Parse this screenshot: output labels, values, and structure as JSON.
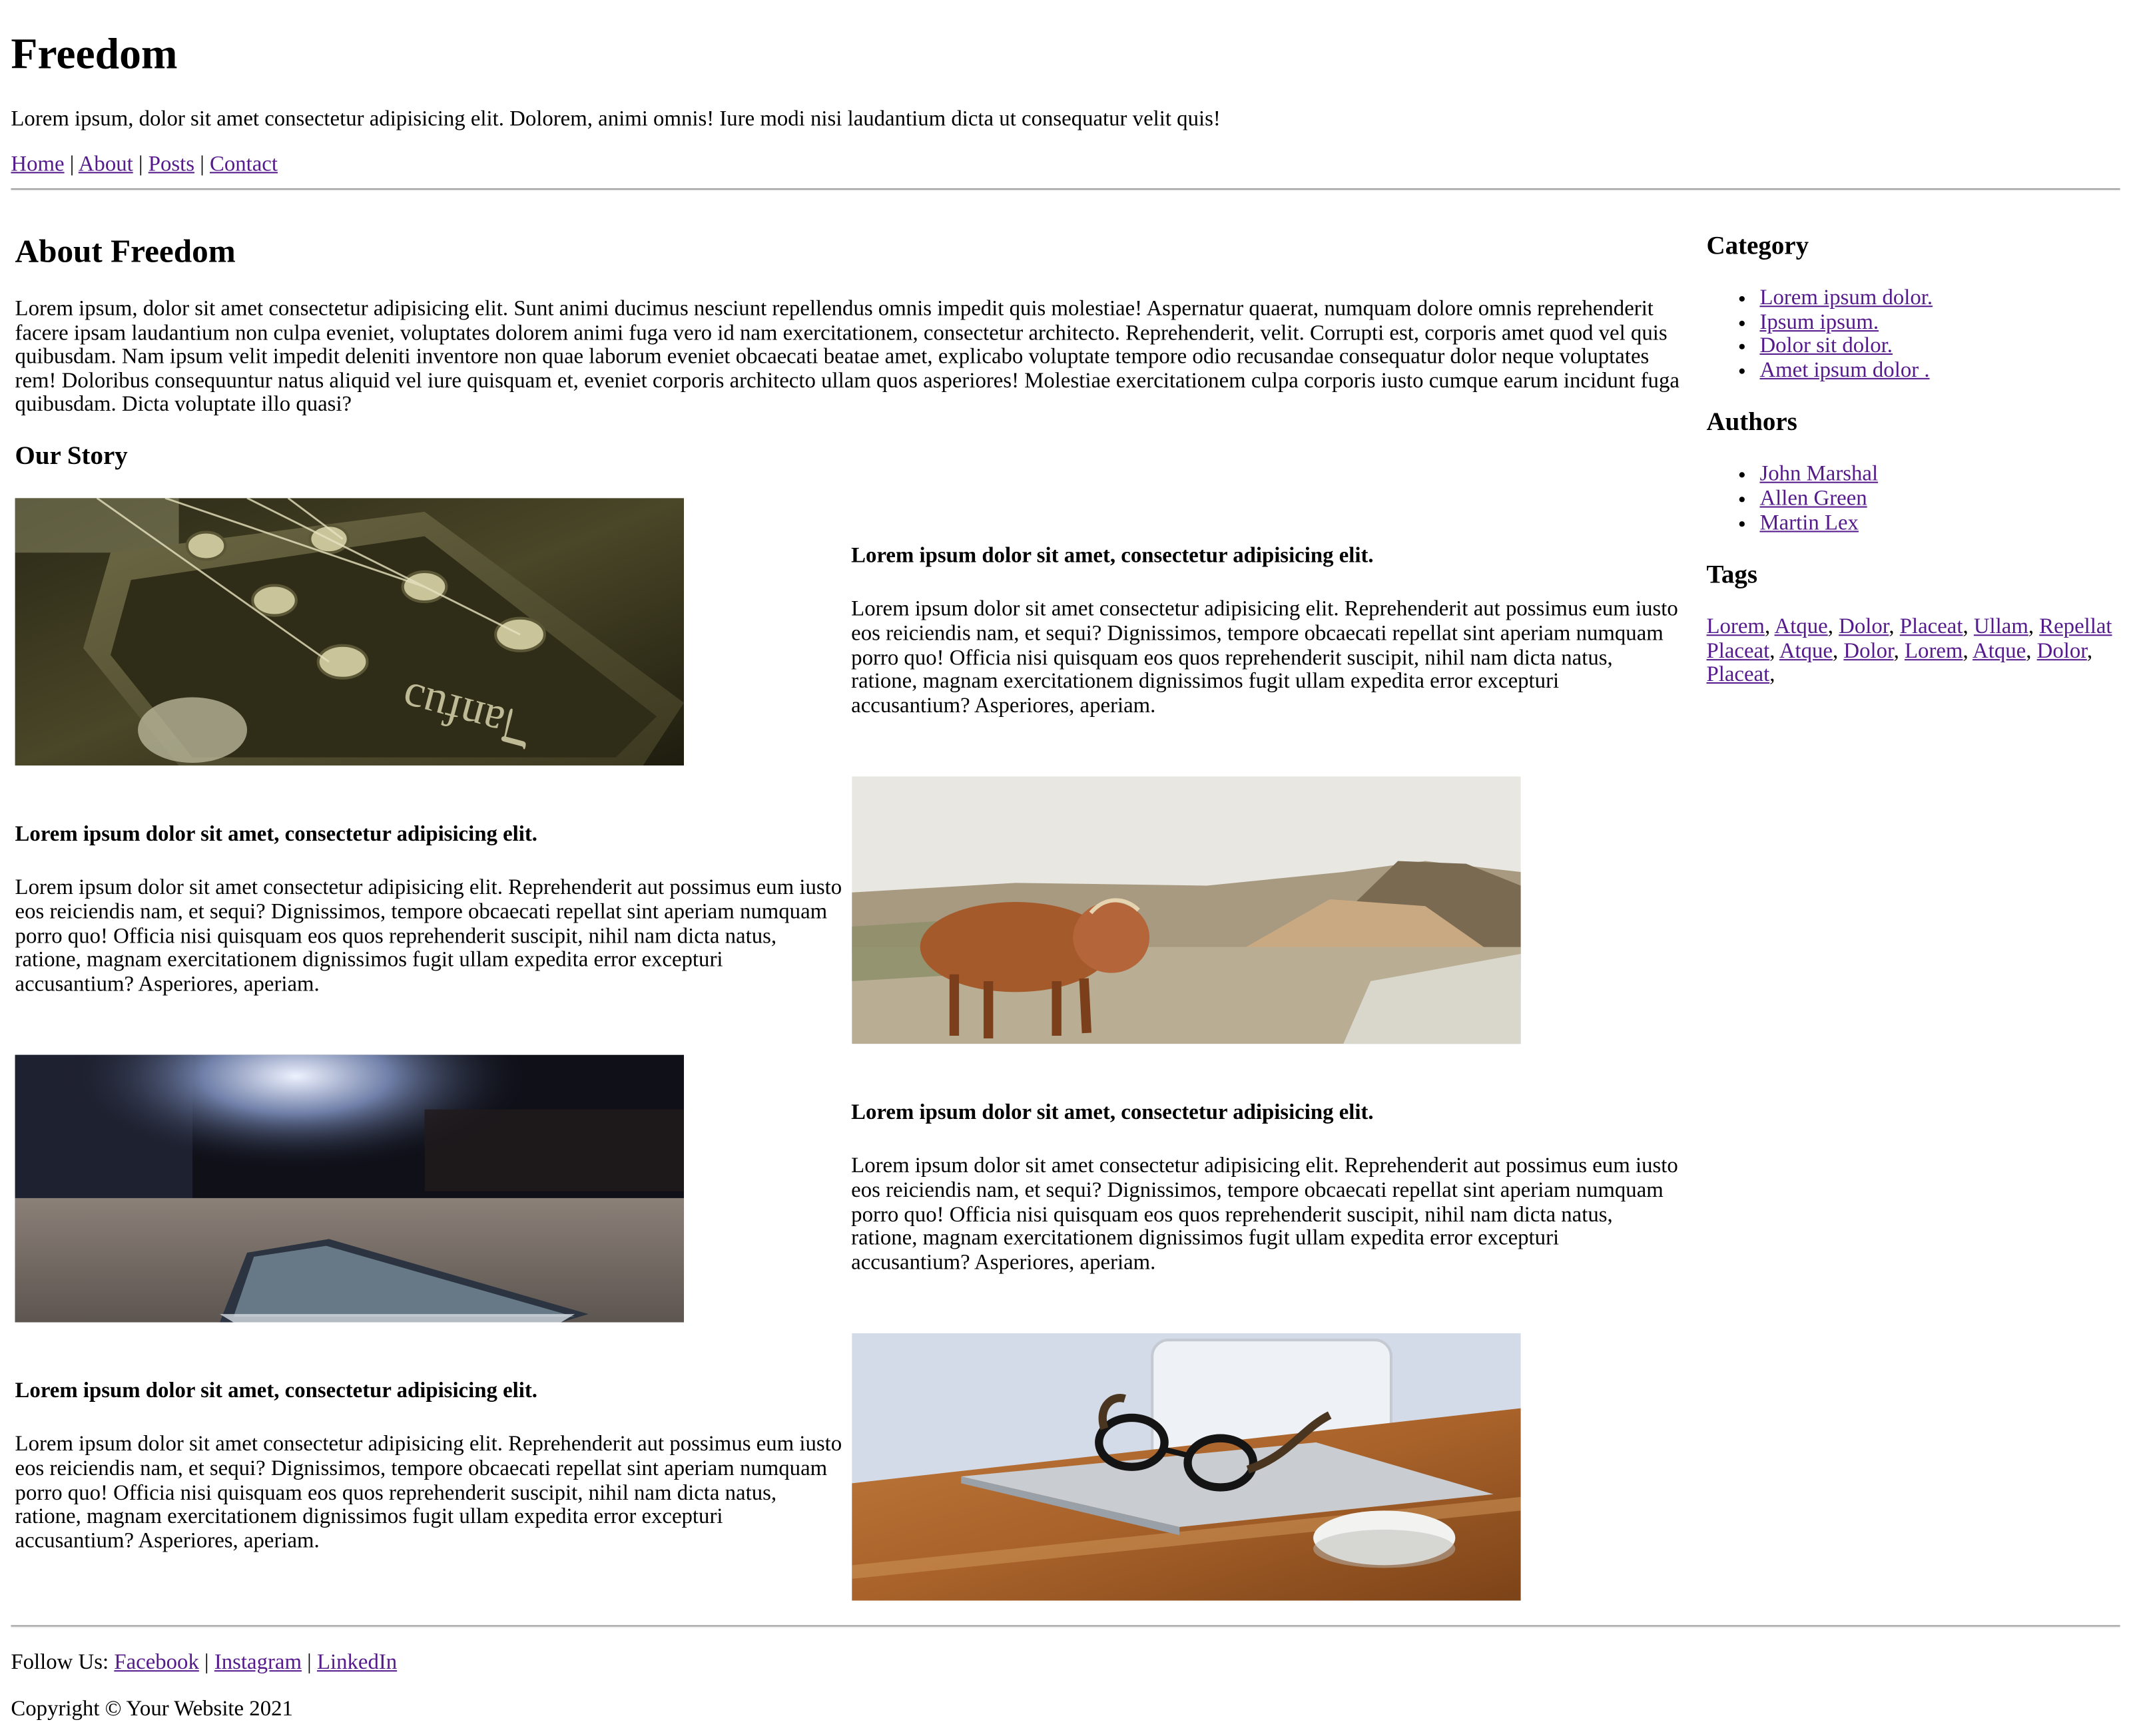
{
  "header": {
    "title": "Freedom",
    "tagline": "Lorem ipsum, dolor sit amet consectetur adipisicing elit. Dolorem, animi omnis! Iure modi nisi laudantium dicta ut consequatur velit quis!",
    "nav": [
      {
        "label": "Home"
      },
      {
        "label": "About"
      },
      {
        "label": "Posts"
      },
      {
        "label": "Contact"
      }
    ],
    "nav_separator": "|"
  },
  "about": {
    "title": "About Freedom",
    "text": "Lorem ipsum, dolor sit amet consectetur adipisicing elit. Sunt animi ducimus nesciunt repellendus omnis impedit quis molestiae! Aspernatur quaerat, numquam dolore omnis reprehenderit facere ipsam laudantium non culpa eveniet, voluptates dolorem animi fuga vero id nam exercitationem, consectetur architecto. Reprehenderit, velit. Corrupti est, corporis amet quod vel quis quibusdam. Nam ipsum velit impedit deleniti inventore non quae laborum eveniet obcaecati beatae amet, explicabo voluptate tempore odio recusandae consequatur dolor neque voluptates rem! Doloribus consequuntur natus aliquid vel iure quisquam et, eveniet corporis architecto ullam quos asperiores! Molestiae exercitationem culpa corporis iusto cumque earum incidunt fuga quibusdam. Dicta voluptate illo quasi?"
  },
  "story": {
    "title": "Our Story",
    "rows": [
      {
        "image": "guitar-headstock-photo",
        "heading": "Lorem ipsum dolor sit amet, consectetur adipisicing elit.",
        "body": "Lorem ipsum dolor sit amet consectetur adipisicing elit. Reprehenderit aut possimus eum iusto eos reiciendis nam, et sequi? Dignissimos, tempore obcaecati repellat sint aperiam numquam porro quo! Officia nisi quisquam eos quos reprehenderit suscipit, nihil nam dicta natus, ratione, magnam exercitationem dignissimos fugit ullam expedita error excepturi accusantium? Asperiores, aperiam."
      },
      {
        "image": "highland-cow-photo",
        "heading": "Lorem ipsum dolor sit amet, consectetur adipisicing elit.",
        "body": "Lorem ipsum dolor sit amet consectetur adipisicing elit. Reprehenderit aut possimus eum iusto eos reiciendis nam, et sequi? Dignissimos, tempore obcaecati repellat sint aperiam numquam porro quo! Officia nisi quisquam eos quos reprehenderit suscipit, nihil nam dicta natus, ratione, magnam exercitationem dignissimos fugit ullam expedita error excepturi accusantium? Asperiores, aperiam."
      },
      {
        "image": "phone-on-table-photo",
        "heading": "Lorem ipsum dolor sit amet, consectetur adipisicing elit.",
        "body": "Lorem ipsum dolor sit amet consectetur adipisicing elit. Reprehenderit aut possimus eum iusto eos reiciendis nam, et sequi? Dignissimos, tempore obcaecati repellat sint aperiam numquam porro quo! Officia nisi quisquam eos quos reprehenderit suscipit, nihil nam dicta natus, ratione, magnam exercitationem dignissimos fugit ullam expedita error excepturi accusantium? Asperiores, aperiam."
      },
      {
        "image": "laptop-glasses-mouse-photo",
        "heading": "Lorem ipsum dolor sit amet, consectetur adipisicing elit.",
        "body": "Lorem ipsum dolor sit amet consectetur adipisicing elit. Reprehenderit aut possimus eum iusto eos reiciendis nam, et sequi? Dignissimos, tempore obcaecati repellat sint aperiam numquam porro quo! Officia nisi quisquam eos quos reprehenderit suscipit, nihil nam dicta natus, ratione, magnam exercitationem dignissimos fugit ullam expedita error excepturi accusantium? Asperiores, aperiam."
      }
    ]
  },
  "sidebar": {
    "category": {
      "title": "Category",
      "items": [
        "Lorem ipsum dolor.",
        "Ipsum ipsum.",
        "Dolor sit dolor.",
        "Amet ipsum dolor ."
      ]
    },
    "authors": {
      "title": "Authors",
      "items": [
        "John Marshal",
        "Allen Green",
        "Martin Lex"
      ]
    },
    "tags": {
      "title": "Tags",
      "items": [
        "Lorem",
        "Atque",
        "Dolor",
        "Placeat",
        "Ullam",
        "Repellat",
        "Placeat",
        "Atque",
        "Dolor",
        "Lorem",
        "Atque",
        "Dolor",
        "Placeat"
      ],
      "separator": ","
    }
  },
  "footer": {
    "follow_label": "Follow Us:",
    "links": [
      {
        "label": "Facebook"
      },
      {
        "label": "Instagram"
      },
      {
        "label": "LinkedIn"
      }
    ],
    "separator": "|",
    "copyright": "Copyright © Your Website 2021"
  },
  "colors": {
    "link": "#551a8b",
    "text": "#000000",
    "background": "#ffffff"
  }
}
